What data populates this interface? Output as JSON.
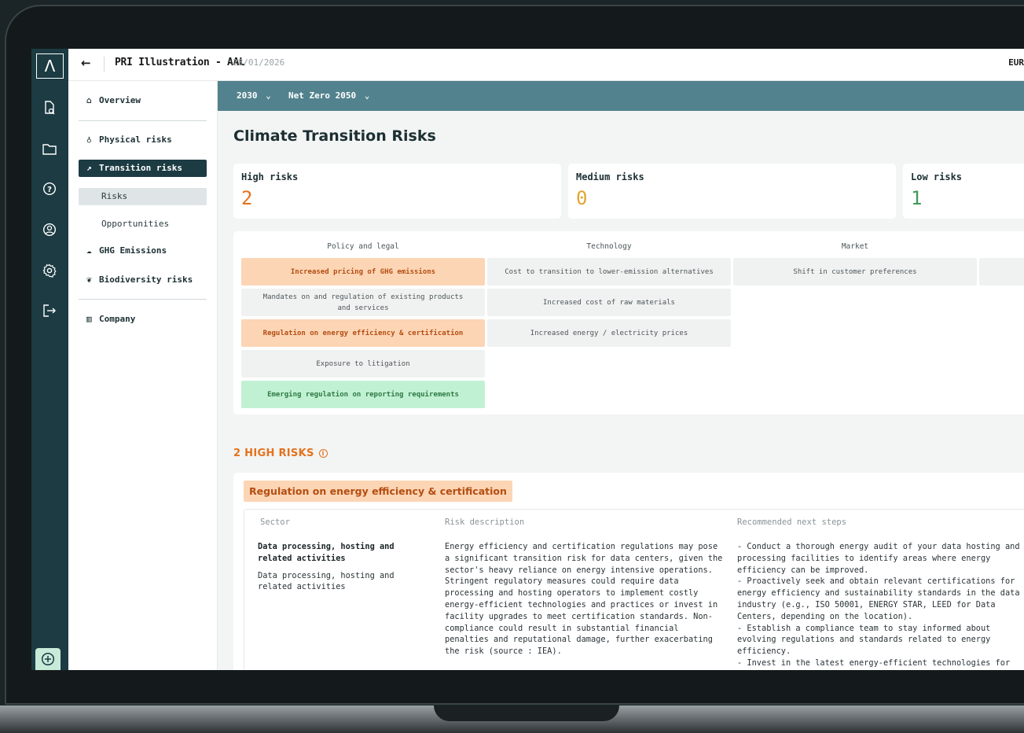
{
  "header": {
    "back_icon": "arrow-left-icon",
    "project_title": "PRI Illustration - AAL",
    "date": "28/01/2026",
    "currency": "EUR"
  },
  "rail": {
    "logo": "Λ",
    "icons": [
      "document-search-icon",
      "folder-icon",
      "help-icon",
      "user-icon",
      "gear-icon",
      "logout-icon"
    ],
    "add_icon": "plus-circle-icon"
  },
  "nav": {
    "overview": "Overview",
    "physical_risks": "Physical risks",
    "transition_risks": "Transition risks",
    "risks": "Risks",
    "opportunities": "Opportunities",
    "ghg_emissions": "GHG Emissions",
    "biodiversity_risks": "Biodiversity risks",
    "company": "Company"
  },
  "filters": {
    "year": "2030",
    "scenario": "Net Zero 2050"
  },
  "main": {
    "title": "Climate Transition Risks"
  },
  "stats": {
    "high": {
      "label": "High risks",
      "value": "2",
      "color": "#e3721c"
    },
    "medium": {
      "label": "Medium risks",
      "value": "0",
      "color": "#e0a630"
    },
    "low": {
      "label": "Low risks",
      "value": "1",
      "color": "#3f9a58"
    }
  },
  "matrix": {
    "columns": [
      "Policy and legal",
      "Technology",
      "Market"
    ],
    "policy_and_legal": [
      "Increased pricing of GHG emissions",
      "Mandates on and regulation of existing products and services",
      "Regulation on energy efficiency & certification",
      "Exposure to litigation",
      "Emerging regulation on reporting requirements"
    ],
    "technology": [
      "Cost to transition to lower-emission alternatives",
      "Increased cost of raw materials",
      "Increased energy / electricity prices"
    ],
    "market": [
      "Shift in customer preferences"
    ]
  },
  "high_risks": {
    "section_title": "2 HIGH RISKS",
    "risk_name": "Regulation on energy efficiency & certification",
    "headers": {
      "sector": "Sector",
      "description": "Risk description",
      "next_steps": "Recommended next steps"
    },
    "sector_title": "Data processing, hosting and related activities",
    "sector_sub": "Data processing, hosting and related activities",
    "description": "Energy efficiency and certification regulations may pose a significant transition risk for data centers, given the sector's heavy reliance on energy intensive operations. Stringent regulatory measures could require data processing and hosting operators to implement costly energy-efficient technologies and practices or invest in facility upgrades to meet certification standards. Non-compliance could result in substantial financial penalties and reputational damage, further exacerbating the risk (source : IEA).",
    "next_steps": "- Conduct a thorough energy audit of your data hosting and processing facilities to identify areas where energy efficiency can be improved.\n- Proactively seek and obtain relevant certifications for energy efficiency and sustainability standards in the data industry (e.g., ISO 50001, ENERGY STAR, LEED for Data Centers, depending on the location).\n- Establish a compliance team to stay informed about evolving regulations and standards related to energy efficiency.\n- Invest in the latest energy-efficient technologies for servers, cooling systems, and lighting.\n- Implement virtualization and consolidation strategies to"
  }
}
